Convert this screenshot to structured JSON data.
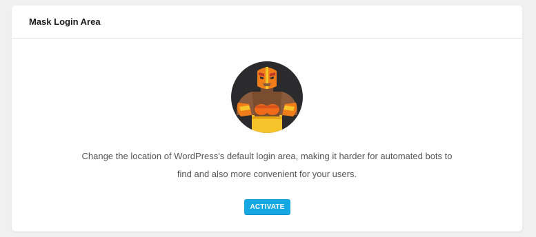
{
  "card": {
    "title": "Mask Login Area"
  },
  "hero": {
    "icon": "masked-wrestler-icon"
  },
  "description": {
    "line1": "Change the location of WordPress's default login area, making it harder for automated bots to",
    "line2": "find and also more convenient for your users."
  },
  "actions": {
    "activate_label": "ACTIVATE"
  },
  "colors": {
    "accent": "#17a8e3",
    "background": "#f0f0f1",
    "card": "#ffffff",
    "text": "#555555"
  }
}
